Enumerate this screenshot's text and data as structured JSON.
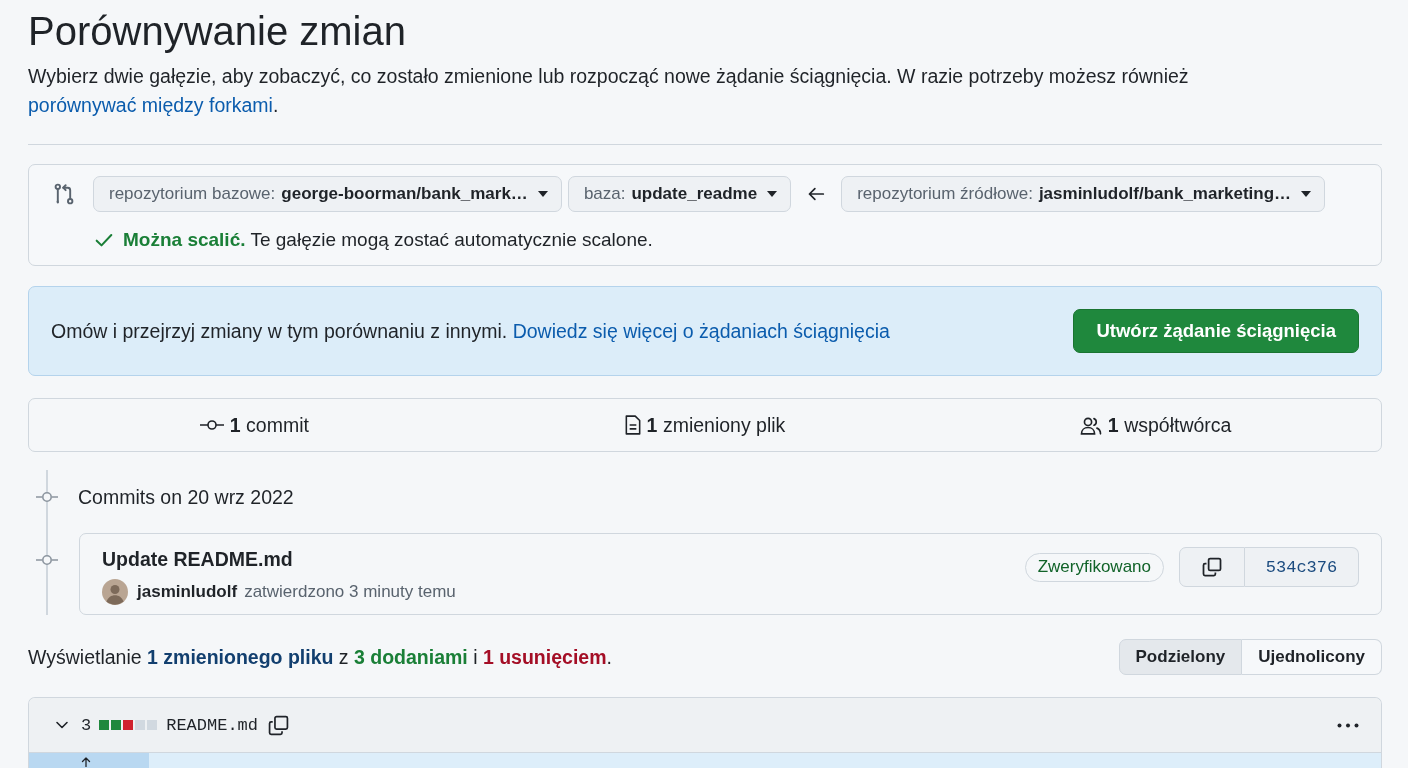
{
  "header": {
    "title": "Porównywanie zmian",
    "description": "Wybierz dwie gałęzie, aby zobaczyć, co zostało zmienione lub rozpocząć nowe żądanie ściągnięcia. W razie potrzeby możesz również ",
    "link": "porównywać między forkami",
    "end": "."
  },
  "range": {
    "base_repository": {
      "label": "repozytorium bazowe:",
      "value": "george-boorman/bank_mark…"
    },
    "base": {
      "label": "baza:",
      "value": "update_readme"
    },
    "head_repository": {
      "label": "repozytorium źródłowe:",
      "value": "jasminludolf/bank_marketing…"
    }
  },
  "merge_status": {
    "mergeable": true,
    "title": "Można scalić.",
    "message": "Te gałęzie mogą zostać automatycznie scalone."
  },
  "banner": {
    "text": "Omów i przejrzyj zmiany w tym porównaniu z innymi.",
    "link": "Dowiedz się więcej o żądaniach ściągnięcia",
    "button": "Utwórz żądanie ściągnięcia"
  },
  "stats": [
    {
      "kind": "commits",
      "text": "**1** commit"
    },
    {
      "kind": "files",
      "text": "**1** zmieniony plik"
    },
    {
      "kind": "contributors",
      "text": "**1** współtwórca"
    }
  ],
  "commit_groups": [
    {
      "heading": "Commits on 20 wrz 2022",
      "commits": [
        {
          "title": "Update README.md",
          "author": "jasminludolf",
          "meta": "zatwierdzono 3 minuty temu",
          "badge": "Zweryfikowano",
          "sha": "534c376"
        }
      ]
    }
  ],
  "summary": [
    {
      "kind": "plain",
      "text": "Wyświetlanie "
    },
    {
      "kind": "files",
      "text": "1 zmienionego pliku"
    },
    {
      "kind": "plain",
      "text": " z "
    },
    {
      "kind": "additions",
      "text": "3 dodaniami"
    },
    {
      "kind": "plain",
      "text": " i "
    },
    {
      "kind": "deletions",
      "text": "1 usunięciem"
    },
    {
      "kind": "plain",
      "text": "."
    }
  ],
  "view_toggle": [
    {
      "label": "Podzielony",
      "selected": true
    },
    {
      "label": "Ujednolicony",
      "selected": false
    }
  ],
  "file": {
    "expanded": true,
    "changes": "3",
    "diffstat": [
      {
        "kind": "added"
      },
      {
        "kind": "added"
      },
      {
        "kind": "deleted"
      },
      {
        "kind": "neutral"
      },
      {
        "kind": "neutral"
      }
    ],
    "name": "README.md"
  }
}
